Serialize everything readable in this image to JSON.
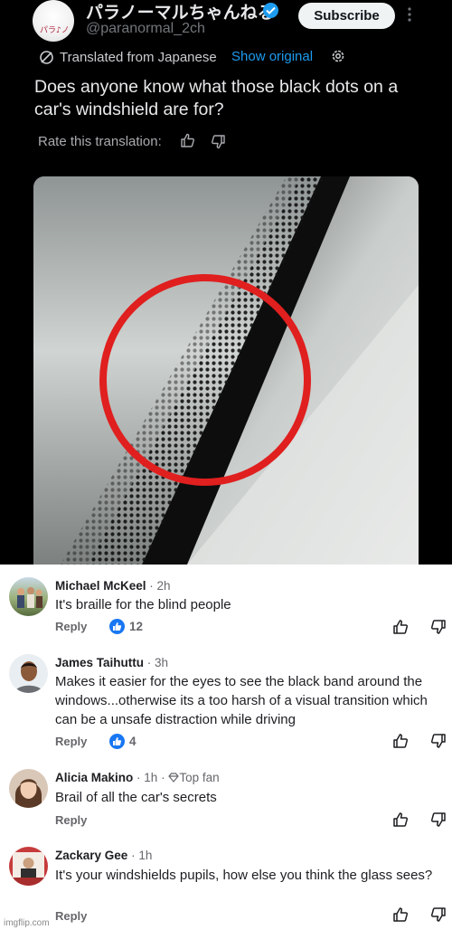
{
  "tweet": {
    "account_name": "パラノーマルちゃんねる",
    "handle": "@paranormal_2ch",
    "avatar_text": "パラ♪ノ",
    "subscribe_label": "Subscribe",
    "more_icon": "more-vertical-icon",
    "translated_label": "Translated from Japanese",
    "show_original_label": "Show original",
    "text": "Does anyone know what those black dots on a car's windshield are for?",
    "rate_label": "Rate this translation:",
    "accent_color": "#1d9bf0"
  },
  "comments": [
    {
      "name": "Michael McKeel",
      "time": "2h",
      "badge": "",
      "text": "It's braille for the blind people",
      "reply_label": "Reply",
      "likes": "12"
    },
    {
      "name": "James Taihuttu",
      "time": "3h",
      "badge": "",
      "text": "Makes it easier for the eyes to see the black band around the windows...otherwise its a too harsh of a  visual transition which can be a unsafe distraction while driving",
      "reply_label": "Reply",
      "likes": "4"
    },
    {
      "name": "Alicia Makino",
      "time": "1h",
      "badge": "Top fan",
      "text": "Brail of all the car's secrets",
      "reply_label": "Reply",
      "likes": ""
    },
    {
      "name": "Zackary Gee",
      "time": "1h",
      "badge": "",
      "text": "It's your windshields pupils, how else you think the glass sees?",
      "reply_label": "Reply",
      "likes": ""
    }
  ],
  "watermark": "imgflip.com",
  "like_color": "#1877f2"
}
